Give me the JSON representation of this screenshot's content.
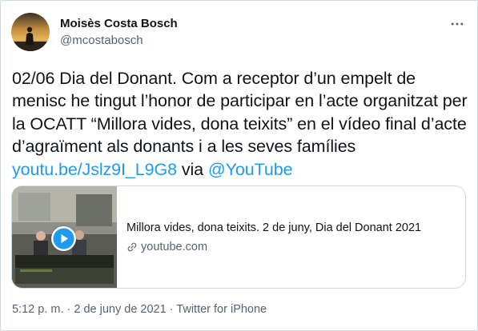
{
  "author": {
    "name": "Moisès Costa Bosch",
    "handle": "@mcostabosch",
    "avatar_icon": "profile-photo-silhouette"
  },
  "tweet": {
    "text_before_link": "02/06 Dia del Donant. Com a receptor d’un empelt de menisc he tingut l’honor de participar en l’acte organitzat per la OCATT “Millora vides, dona teixits” en el vídeo final d’acte d’agraïment als donants i a les seves famílies ",
    "link": "youtu.be/Jslz9I_L9G8",
    "text_between": " via ",
    "mention": "@YouTube"
  },
  "card": {
    "title": "Millora vides, dona teixits. 2 de juny, Dia del Donant 2021",
    "domain": "youtube.com",
    "play_icon": "play-icon",
    "link_icon": "link-icon"
  },
  "meta": {
    "time": "5:12 p. m.",
    "separator1": " · ",
    "date": "2 de juny de 2021",
    "separator2": " · ",
    "source": "Twitter for iPhone"
  },
  "colors": {
    "link": "#1d9bf0",
    "secondary_text": "#536471",
    "border": "#cfd9de"
  }
}
